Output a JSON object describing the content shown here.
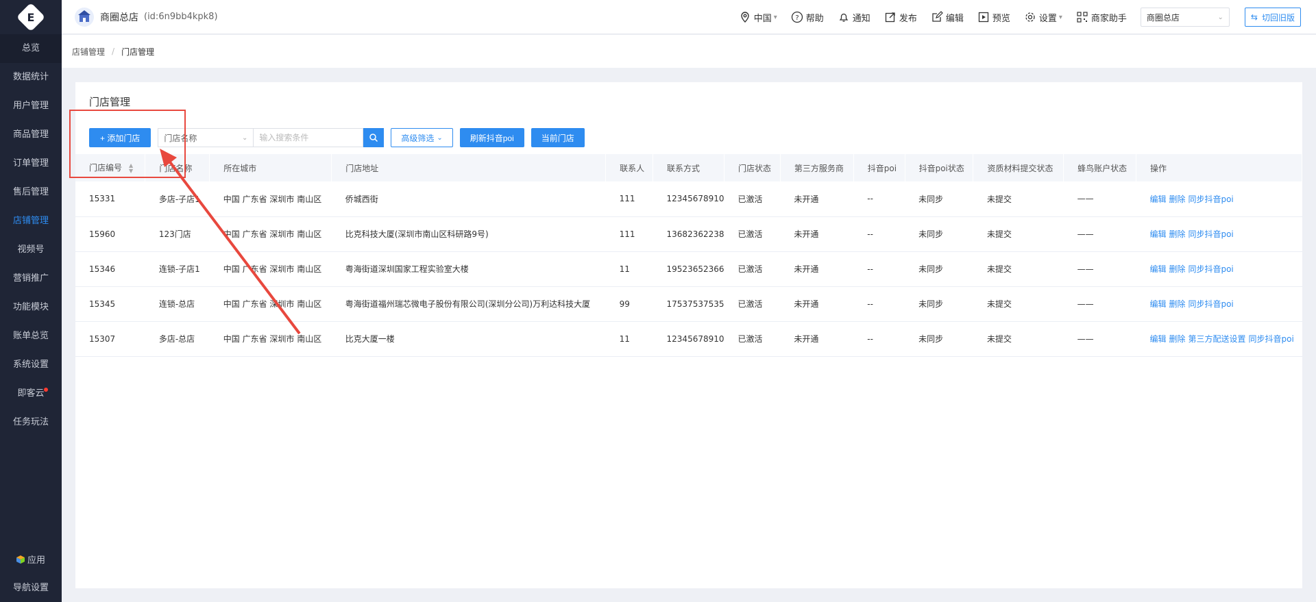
{
  "sidebar": {
    "logo_text": "E",
    "items": [
      {
        "label": "总览"
      },
      {
        "label": "数据统计"
      },
      {
        "label": "用户管理"
      },
      {
        "label": "商品管理"
      },
      {
        "label": "订单管理"
      },
      {
        "label": "售后管理"
      },
      {
        "label": "店铺管理",
        "active": true
      },
      {
        "label": "视频号"
      },
      {
        "label": "营销推广"
      },
      {
        "label": "功能模块"
      },
      {
        "label": "账单总览"
      },
      {
        "label": "系统设置"
      },
      {
        "label": "即客云",
        "dot": true
      },
      {
        "label": "任务玩法"
      }
    ],
    "bottom": {
      "apps": "应用",
      "nav_settings": "导航设置"
    }
  },
  "header": {
    "brand_name": "商圈总店",
    "brand_id": "(id:6n9bb4kpk8)",
    "region": "中国",
    "help": "帮助",
    "notify": "通知",
    "publish": "发布",
    "edit": "编辑",
    "preview": "预览",
    "settings": "设置",
    "assistant": "商家助手",
    "store_select": "商圈总店",
    "old_version": "切回旧版"
  },
  "breadcrumb": {
    "parent": "店铺管理",
    "separator": "/",
    "current": "门店管理"
  },
  "page": {
    "title": "门店管理",
    "add_store": "+ 添加门店",
    "filter_field": "门店名称",
    "search_placeholder": "输入搜索条件",
    "advanced_filter": "高级筛选",
    "refresh_poi": "刷新抖音poi",
    "current_store": "当前门店"
  },
  "table": {
    "columns": [
      "门店编号",
      "门店名称",
      "所在城市",
      "门店地址",
      "联系人",
      "联系方式",
      "门店状态",
      "第三方服务商",
      "抖音poi",
      "抖音poi状态",
      "资质材料提交状态",
      "蜂鸟账户状态",
      "操作"
    ],
    "rows": [
      {
        "id": "15331",
        "name": "多店-子店1",
        "city": "中国 广东省 深圳市 南山区",
        "address": "侨城西街",
        "contact": "111",
        "phone": "12345678910",
        "status": "已激活",
        "provider": "未开通",
        "poi": "--",
        "poi_status": "未同步",
        "qualification": "未提交",
        "fengniao": "——",
        "ops": [
          "编辑",
          "删除",
          "同步抖音poi"
        ]
      },
      {
        "id": "15960",
        "name": "123门店",
        "city": "中国 广东省 深圳市 南山区",
        "address": "比克科技大厦(深圳市南山区科研路9号)",
        "contact": "111",
        "phone": "13682362238",
        "status": "已激活",
        "provider": "未开通",
        "poi": "--",
        "poi_status": "未同步",
        "qualification": "未提交",
        "fengniao": "——",
        "ops": [
          "编辑",
          "删除",
          "同步抖音poi"
        ]
      },
      {
        "id": "15346",
        "name": "连锁-子店1",
        "city": "中国 广东省 深圳市 南山区",
        "address": "粤海街道深圳国家工程实验室大楼",
        "contact": "11",
        "phone": "19523652366",
        "status": "已激活",
        "provider": "未开通",
        "poi": "--",
        "poi_status": "未同步",
        "qualification": "未提交",
        "fengniao": "——",
        "ops": [
          "编辑",
          "删除",
          "同步抖音poi"
        ]
      },
      {
        "id": "15345",
        "name": "连锁-总店",
        "city": "中国 广东省 深圳市 南山区",
        "address": "粤海街道福州瑞芯微电子股份有限公司(深圳分公司)万利达科技大厦",
        "contact": "99",
        "phone": "17537537535",
        "status": "已激活",
        "provider": "未开通",
        "poi": "--",
        "poi_status": "未同步",
        "qualification": "未提交",
        "fengniao": "——",
        "ops": [
          "编辑",
          "删除",
          "同步抖音poi"
        ]
      },
      {
        "id": "15307",
        "name": "多店-总店",
        "city": "中国 广东省 深圳市 南山区",
        "address": "比克大厦一楼",
        "contact": "11",
        "phone": "12345678910",
        "status": "已激活",
        "provider": "未开通",
        "poi": "--",
        "poi_status": "未同步",
        "qualification": "未提交",
        "fengniao": "——",
        "ops": [
          "编辑",
          "删除",
          "第三方配送设置",
          "同步抖音poi"
        ]
      }
    ]
  },
  "colors": {
    "accent": "#2e8cf0",
    "sidebar_bg": "#1f2536",
    "annotation": "#e8483e"
  }
}
